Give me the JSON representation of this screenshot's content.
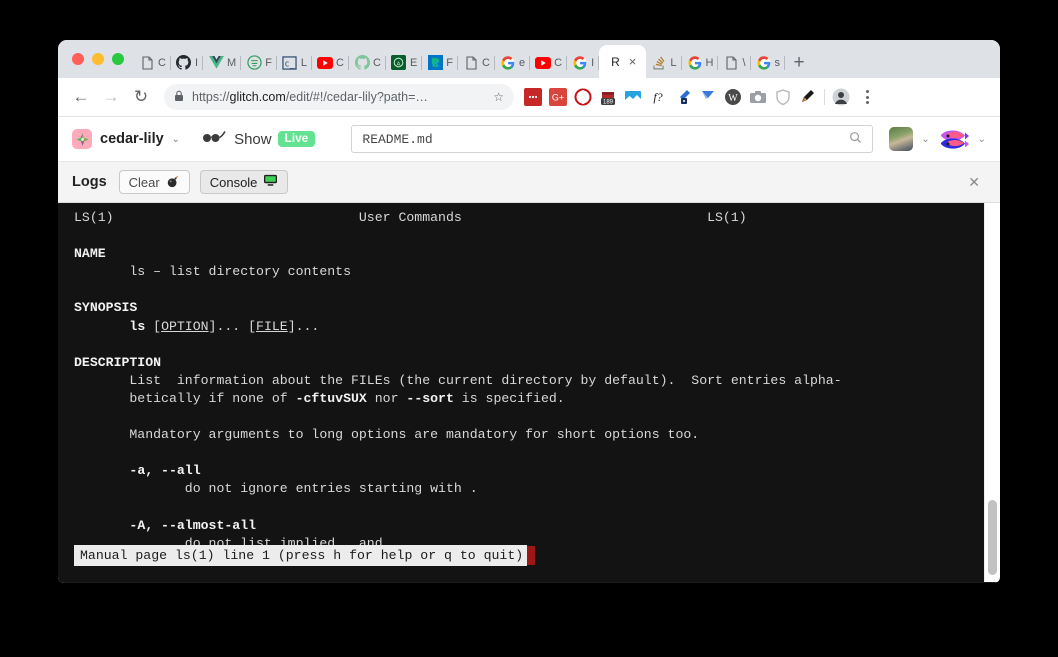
{
  "browser": {
    "traffic_lights": [
      "close",
      "minimize",
      "zoom"
    ],
    "tabs": [
      {
        "label": "C",
        "icon": "document-icon"
      },
      {
        "label": "I",
        "icon": "github-icon"
      },
      {
        "label": "M",
        "icon": "vue-icon"
      },
      {
        "label": "F",
        "icon": "flask-icon"
      },
      {
        "label": "L",
        "icon": "codepen-icon"
      },
      {
        "label": "C",
        "icon": "youtube-icon"
      },
      {
        "label": "C",
        "icon": "github-outline-icon"
      },
      {
        "label": "E",
        "icon": "android-icon"
      },
      {
        "label": "F",
        "icon": "revolut-icon"
      },
      {
        "label": "C",
        "icon": "document-icon"
      },
      {
        "label": "e",
        "icon": "google-icon"
      },
      {
        "label": "C",
        "icon": "youtube-icon"
      },
      {
        "label": "I",
        "icon": "google-icon"
      },
      {
        "label": "R",
        "icon": "glitch-tab-icon",
        "active": true,
        "close": "×"
      },
      {
        "label": "L",
        "icon": "stackoverflow-icon"
      },
      {
        "label": "H",
        "icon": "google-icon"
      },
      {
        "label": "\\",
        "icon": "document-icon"
      },
      {
        "label": "s",
        "icon": "google-icon"
      }
    ],
    "new_tab_label": "+",
    "nav": {
      "back": "←",
      "forward": "→",
      "reload": "↻"
    },
    "omnibox": {
      "lock_icon": "lock-icon",
      "url_prefix": "https://",
      "url_domain": "glitch.com",
      "url_path": "/edit/#!/cedar-lily?path=…",
      "star_icon": "☆"
    },
    "extensions": [
      {
        "name": "red-dots-extension",
        "glyph": "•••"
      },
      {
        "name": "google-plus-extension",
        "glyph": "G+"
      },
      {
        "name": "opera-extension",
        "glyph": "O"
      },
      {
        "name": "calendar-extension",
        "glyph": "189"
      },
      {
        "name": "image-extension",
        "glyph": "▣"
      },
      {
        "name": "font-extension",
        "glyph": "ƒ?"
      },
      {
        "name": "eyedropper-extension",
        "glyph": "✒"
      },
      {
        "name": "y-extension",
        "glyph": "Y"
      },
      {
        "name": "wappalyzer-extension",
        "glyph": "W"
      },
      {
        "name": "camera-extension",
        "glyph": "◎"
      },
      {
        "name": "shield-extension",
        "glyph": "⬡"
      },
      {
        "name": "paint-extension",
        "glyph": "◢"
      }
    ],
    "profile_name": "profile-avatar",
    "menu_name": "browser-menu"
  },
  "glitch": {
    "logo": "glitch-logo",
    "project_name": "cedar-lily",
    "project_chevron": "⌄",
    "show_label": "Show",
    "show_icon": "glasses-icon",
    "live_badge": "Live",
    "file_search_value": "README.md",
    "file_search_placeholder": "README.md",
    "search_icon": "🔍",
    "user_chevron": "⌄",
    "team_chevron": "⌄"
  },
  "logs_panel": {
    "title": "Logs",
    "clear_label": "Clear",
    "clear_icon": "💣",
    "console_label": "Console",
    "console_icon": "🖥",
    "close_icon": "✕"
  },
  "terminal": {
    "header_left": "LS(1)",
    "header_center": "User Commands",
    "header_right": "LS(1)",
    "lines": [
      {
        "text": "LS(1)                               User Commands                               LS(1)",
        "style": "plain"
      },
      {
        "text": "",
        "style": "plain"
      },
      {
        "text": "NAME",
        "style": "bold"
      },
      {
        "text": "       ls – list directory contents",
        "style": "plain"
      },
      {
        "text": "",
        "style": "plain"
      },
      {
        "text": "SYNOPSIS",
        "style": "bold"
      },
      {
        "text": "       ls [OPTION]... [FILE]...",
        "style": "synopsis"
      },
      {
        "text": "",
        "style": "plain"
      },
      {
        "text": "DESCRIPTION",
        "style": "bold"
      },
      {
        "text": "       List  information about the FILEs (the current directory by default).  Sort entries alpha-",
        "style": "plain"
      },
      {
        "text": "       betically if none of -cftuvSUX nor --sort is specified.",
        "style": "desc2"
      },
      {
        "text": "",
        "style": "plain"
      },
      {
        "text": "       Mandatory arguments to long options are mandatory for short options too.",
        "style": "plain"
      },
      {
        "text": "",
        "style": "plain"
      },
      {
        "text": "       -a, --all",
        "style": "bold-opt"
      },
      {
        "text": "              do not ignore entries starting with .",
        "style": "plain"
      },
      {
        "text": "",
        "style": "plain"
      },
      {
        "text": "       -A, --almost-all",
        "style": "bold-opt"
      },
      {
        "text": "              do not list implied . and ..",
        "style": "plain"
      }
    ],
    "status_text": "Manual page ls(1) line 1 (press h for help or q to quit)",
    "cursor": "block"
  },
  "colors": {
    "accent_live": "#63e292",
    "terminal_bg": "#131313",
    "terminal_fg": "#d8d8d8",
    "status_bg": "#ececec",
    "cursor": "#9e1616",
    "glitch_pink": "#ffaabb"
  }
}
